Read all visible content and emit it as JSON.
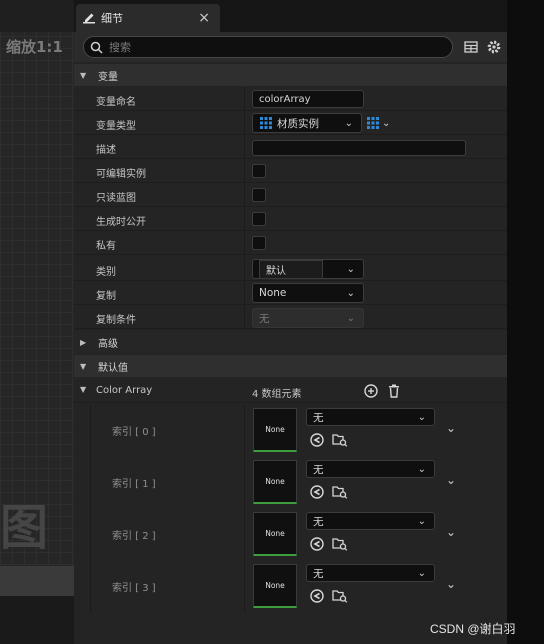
{
  "graph": {
    "zoom_label": "缩放1:1",
    "watermark": "图"
  },
  "tab": {
    "title": "细节",
    "close": "×"
  },
  "search": {
    "placeholder": "搜索"
  },
  "sections": {
    "variables": "变量",
    "advanced": "高级",
    "default_value": "默认值"
  },
  "variables": {
    "name_label": "变量命名",
    "name_value": "colorArray",
    "type_label": "变量类型",
    "type_value": "材质实例",
    "description_label": "描述",
    "description_value": "",
    "instance_editable_label": "可编辑实例",
    "blueprint_readonly_label": "只读蓝图",
    "expose_on_spawn_label": "生成时公开",
    "private_label": "私有",
    "category_label": "类别",
    "category_value": "默认",
    "replication_label": "复制",
    "replication_value": "None",
    "replication_condition_label": "复制条件",
    "replication_condition_value": "无"
  },
  "color_array": {
    "label": "Color Array",
    "count_text": "4 数组元素",
    "elements": [
      {
        "label": "索引 [ 0 ]",
        "thumb": "None",
        "value": "无"
      },
      {
        "label": "索引 [ 1 ]",
        "thumb": "None",
        "value": "无"
      },
      {
        "label": "索引 [ 2 ]",
        "thumb": "None",
        "value": "无"
      },
      {
        "label": "索引 [ 3 ]",
        "thumb": "None",
        "value": "无"
      }
    ]
  },
  "watermark_text": "CSDN @谢白羽",
  "colors": {
    "accent_blue": "#2e8ad8",
    "thumb_green": "#3d9c3d"
  }
}
